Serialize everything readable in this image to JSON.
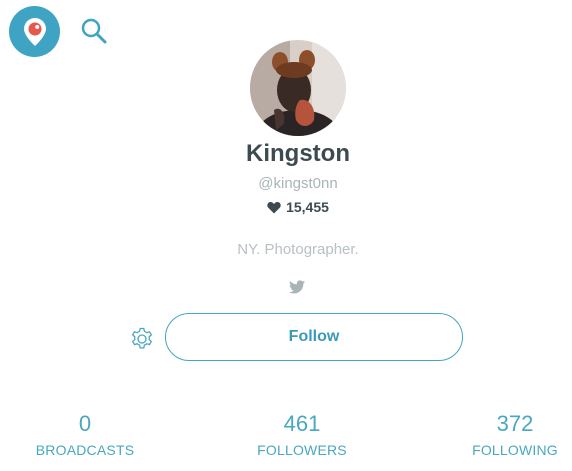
{
  "app": {
    "logo_icon": "periscope-logo-icon",
    "search_icon": "search-icon",
    "accent_color": "#3fa4c4"
  },
  "profile": {
    "name": "Kingston",
    "handle": "@kingst0nn",
    "hearts_icon": "heart-icon",
    "hearts_count": "15,455",
    "bio": "NY. Photographer.",
    "twitter_icon": "twitter-icon"
  },
  "actions": {
    "settings_icon": "gear-icon",
    "follow_label": "Follow"
  },
  "stats": [
    {
      "value": "0",
      "label": "BROADCASTS"
    },
    {
      "value": "461",
      "label": "FOLLOWERS"
    },
    {
      "value": "372",
      "label": "FOLLOWING"
    }
  ]
}
